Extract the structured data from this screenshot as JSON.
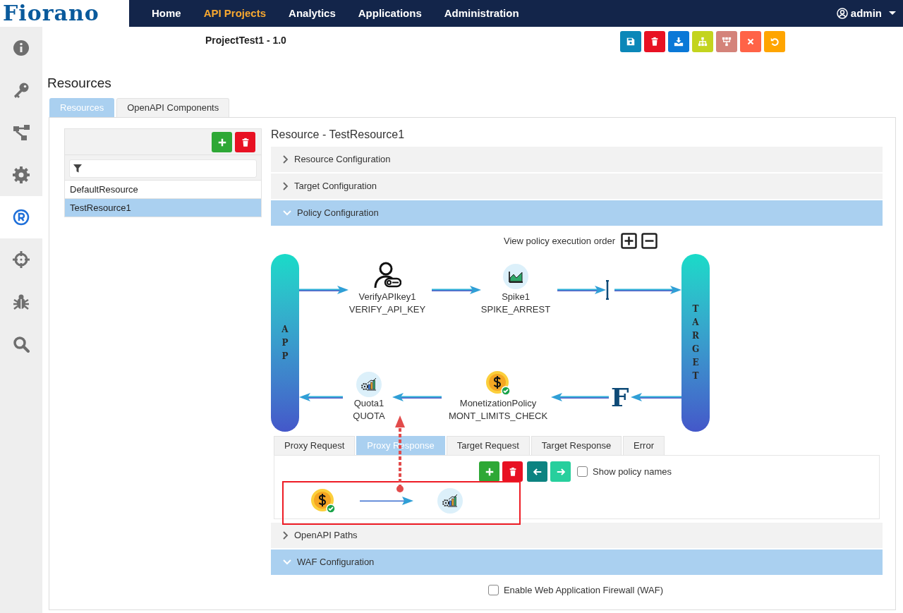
{
  "logo": {
    "text": "Fiorano"
  },
  "nav": {
    "items": [
      {
        "label": "Home",
        "selected": false
      },
      {
        "label": "API Projects",
        "selected": true
      },
      {
        "label": "Analytics",
        "selected": false
      },
      {
        "label": "Applications",
        "selected": false
      },
      {
        "label": "Administration",
        "selected": false
      }
    ],
    "user": "admin"
  },
  "sidebar": {
    "items": [
      {
        "kind": "info",
        "selected": false
      },
      {
        "kind": "key",
        "selected": false
      },
      {
        "kind": "hierarchy",
        "selected": false
      },
      {
        "kind": "gear",
        "selected": false
      },
      {
        "kind": "registered",
        "selected": true
      },
      {
        "kind": "crosshair",
        "selected": false
      },
      {
        "kind": "bug",
        "selected": false
      },
      {
        "kind": "search",
        "selected": false
      }
    ]
  },
  "project_title": "ProjectTest1 - 1.0",
  "toolbar": [
    {
      "kind": "save"
    },
    {
      "kind": "delete"
    },
    {
      "kind": "download"
    },
    {
      "kind": "sitemap"
    },
    {
      "kind": "tree"
    },
    {
      "kind": "close"
    },
    {
      "kind": "undo"
    }
  ],
  "page_heading": "Resources",
  "tabs": [
    {
      "label": "Resources",
      "selected": true
    },
    {
      "label": "OpenAPI Components",
      "selected": false
    }
  ],
  "resource_list": {
    "buttons": [
      {
        "kind": "add"
      },
      {
        "kind": "delete"
      }
    ],
    "items": [
      {
        "label": "DefaultResource",
        "selected": false
      },
      {
        "label": "TestResource1",
        "selected": true
      }
    ]
  },
  "detail": {
    "title": "Resource - TestResource1",
    "sections": [
      {
        "label": "Resource Configuration",
        "expanded": false
      },
      {
        "label": "Target Configuration",
        "expanded": false
      },
      {
        "label": "Policy Configuration",
        "expanded": true,
        "execution_order_label": "View policy execution order",
        "flow": {
          "app_label": "APP",
          "target_label": "TARGET",
          "response_mark": "F",
          "request_policies": [
            {
              "kind": "verify",
              "name": "VerifyAPIkey1",
              "type": "VERIFY_API_KEY"
            },
            {
              "kind": "spike",
              "name": "Spike1",
              "type": "SPIKE_ARREST"
            }
          ],
          "response_policies": [
            {
              "kind": "quota",
              "name": "Quota1",
              "type": "QUOTA"
            },
            {
              "kind": "monetization",
              "name": "MonetizationPolicy",
              "type": "MONT_LIMITS_CHECK"
            }
          ]
        },
        "subtabs": [
          {
            "label": "Proxy Request",
            "selected": false
          },
          {
            "label": "Proxy Response",
            "selected": true
          },
          {
            "label": "Target Request",
            "selected": false
          },
          {
            "label": "Target Response",
            "selected": false
          },
          {
            "label": "Error",
            "selected": false
          }
        ],
        "sequence_buttons": [
          {
            "kind": "add"
          },
          {
            "kind": "delete"
          },
          {
            "kind": "left"
          },
          {
            "kind": "right"
          }
        ],
        "show_policy_names": {
          "label": "Show policy names",
          "checked": false
        },
        "sequence": [
          {
            "kind": "monetization"
          },
          {
            "kind": "quota"
          }
        ]
      },
      {
        "label": "OpenAPI Paths",
        "expanded": false
      },
      {
        "label": "WAF Configuration",
        "expanded": true,
        "checkbox": {
          "label": "Enable Web Application Firewall (WAF)",
          "checked": false
        }
      }
    ]
  }
}
